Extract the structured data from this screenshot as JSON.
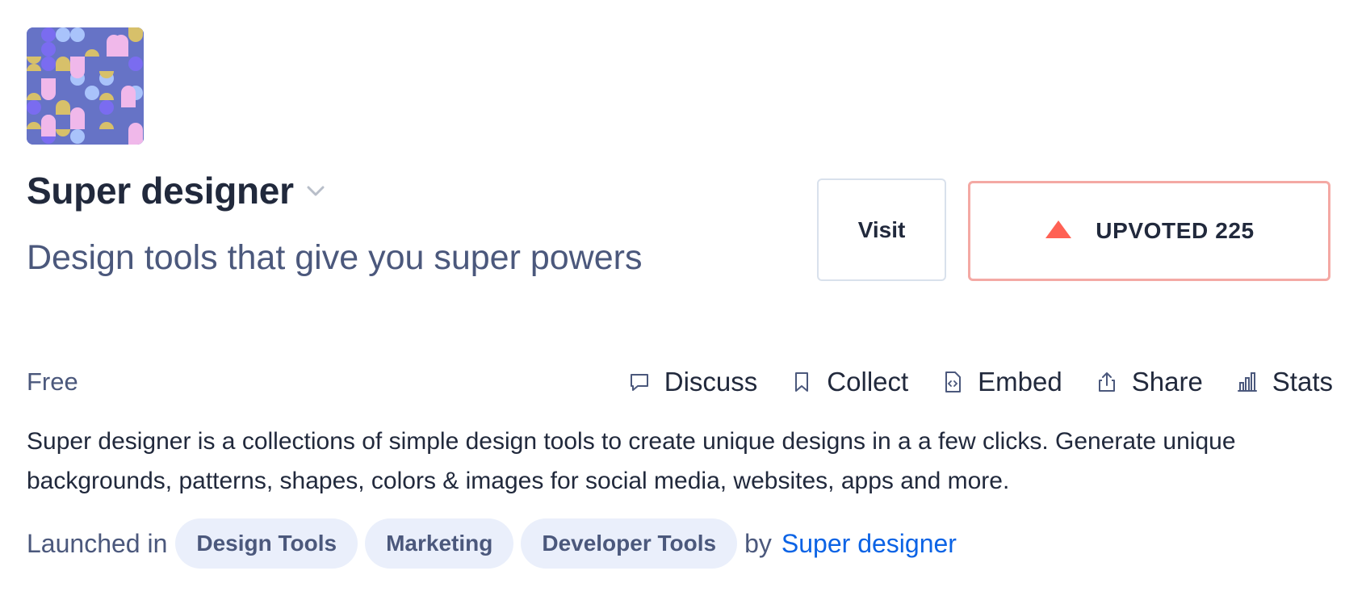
{
  "product": {
    "name": "Super designer",
    "tagline": "Design tools that give you super powers",
    "pricing": "Free",
    "description": "Super designer is a collections of simple design tools to create unique designs in a a few clicks. Generate unique backgrounds, patterns, shapes, colors & images for social media, websites, apps and more."
  },
  "buttons": {
    "visit": "Visit",
    "upvote": "UPVOTED 225"
  },
  "actions": [
    {
      "label": "Discuss",
      "icon": "comment-icon"
    },
    {
      "label": "Collect",
      "icon": "bookmark-icon"
    },
    {
      "label": "Embed",
      "icon": "embed-code-icon"
    },
    {
      "label": "Share",
      "icon": "share-icon"
    },
    {
      "label": "Stats",
      "icon": "bar-chart-icon"
    }
  ],
  "launched": {
    "prefix": "Launched in",
    "topics": [
      "Design Tools",
      "Marketing",
      "Developer Tools"
    ],
    "by": "by",
    "maker": "Super designer"
  },
  "colors": {
    "upvote_accent": "#ff6154",
    "link": "#0b63e5",
    "tag_bg": "#eaeffb"
  }
}
